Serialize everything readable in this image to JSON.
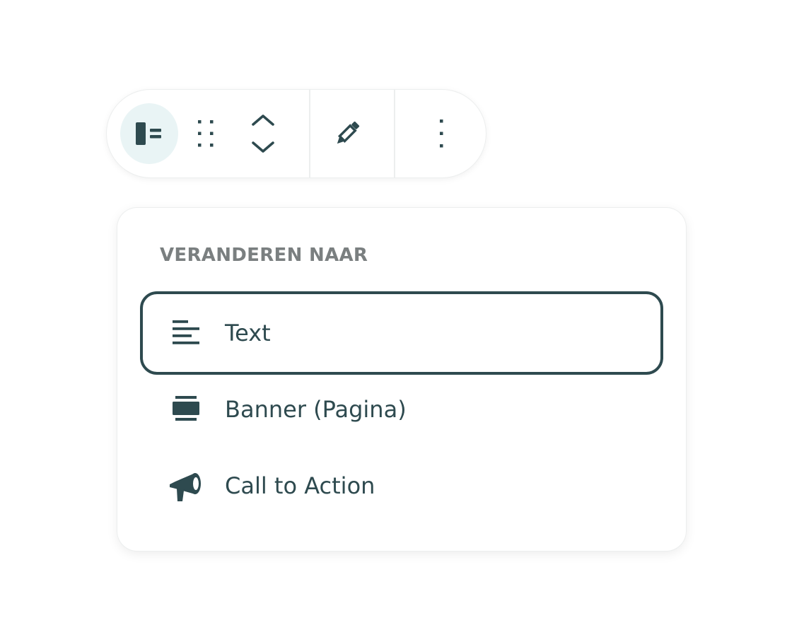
{
  "toolbar": {
    "buttons": [
      {
        "name": "block-type",
        "icon": "block-type-icon"
      },
      {
        "name": "drag",
        "icon": "drag-handle-icon"
      },
      {
        "name": "move",
        "icon": "move-up-down-icon"
      },
      {
        "name": "edit",
        "icon": "pencil-icon"
      },
      {
        "name": "more",
        "icon": "more-vertical-icon"
      }
    ]
  },
  "menu": {
    "heading": "VERANDEREN NAAR",
    "items": [
      {
        "label": "Text",
        "icon": "align-left-icon",
        "selected": true
      },
      {
        "label": "Banner (Pagina)",
        "icon": "banner-icon",
        "selected": false
      },
      {
        "label": "Call to Action",
        "icon": "megaphone-icon",
        "selected": false
      }
    ]
  },
  "colors": {
    "primary": "#2e4a4f",
    "heading": "#7a7f80",
    "active_bg": "#e9f4f5",
    "border": "#eceeee"
  }
}
